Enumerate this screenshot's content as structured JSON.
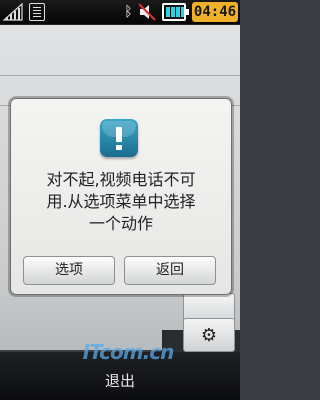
{
  "status_bar": {
    "time": "04:46",
    "icons": [
      "signal-icon",
      "sim-card-icon",
      "bluetooth-icon",
      "mute-icon",
      "battery-icon"
    ]
  },
  "dialog": {
    "icon": "alert-icon",
    "message_lines": [
      "对不起,视频电话不可",
      "用.从选项菜单中选择",
      "一个动作"
    ],
    "buttons": {
      "options": "选项",
      "back": "返回"
    }
  },
  "bottom_bar": {
    "exit_label": "退出"
  },
  "watermark": "ITcom.cn",
  "colors": {
    "time_badge": "#efb02a",
    "alert_icon": "#2a8db3",
    "battery_fill": "#2fd0e0"
  }
}
